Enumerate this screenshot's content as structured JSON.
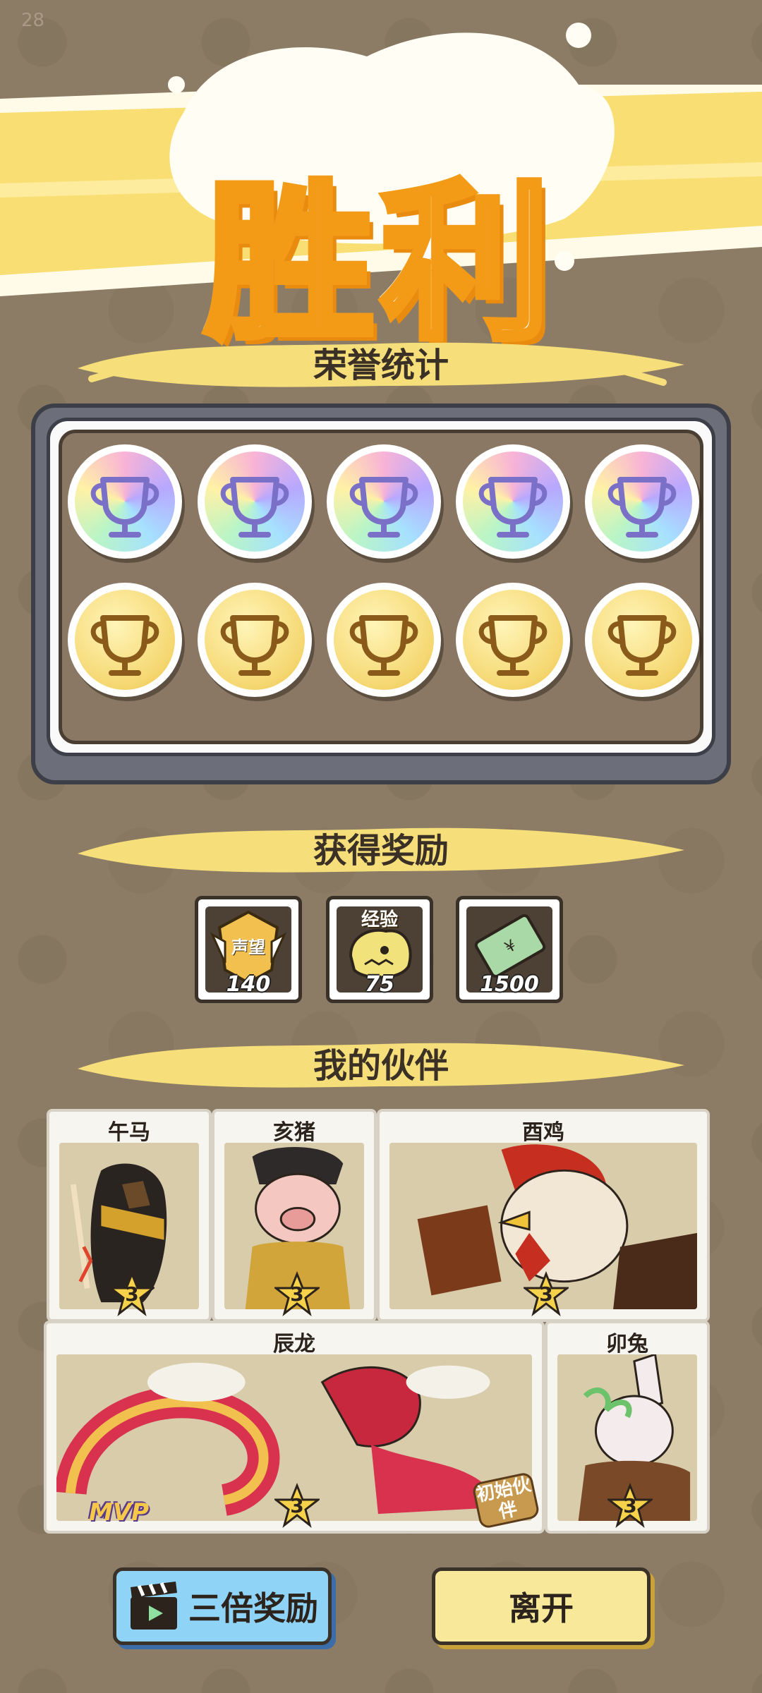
{
  "fps": "28",
  "title": "胜利",
  "sections": {
    "honor": "荣誉统计",
    "rewards": "获得奖励",
    "partners": "我的伙伴"
  },
  "medals": {
    "rainbow_row": [
      "rainbow-trophy-icon",
      "rainbow-trophy-icon",
      "rainbow-trophy-icon",
      "rainbow-trophy-icon",
      "rainbow-trophy-icon"
    ],
    "gold_row": [
      "gold-trophy-icon",
      "gold-trophy-icon",
      "gold-trophy-icon",
      "gold-trophy-icon",
      "gold-trophy-icon"
    ]
  },
  "rewards": [
    {
      "icon": "reputation-badge-icon",
      "badge_text": "声望",
      "amount": "140"
    },
    {
      "icon": "experience-creature-icon",
      "badge_text": "经验",
      "amount": "75"
    },
    {
      "icon": "money-note-icon",
      "badge_text": "",
      "amount": "1500"
    }
  ],
  "partners": [
    {
      "name": "午马",
      "stars": "3"
    },
    {
      "name": "亥猪",
      "stars": "3"
    },
    {
      "name": "酉鸡",
      "stars": "3"
    },
    {
      "name": "辰龙",
      "stars": "3",
      "tag": "MVP",
      "tag2": "初始伙伴"
    },
    {
      "name": "卯兔",
      "stars": "3"
    }
  ],
  "buttons": {
    "triple": "三倍奖励",
    "leave": "离开"
  },
  "colors": {
    "background": "#8c7c66",
    "accent_orange": "#f39a16",
    "banner_yellow": "#f9df73"
  }
}
